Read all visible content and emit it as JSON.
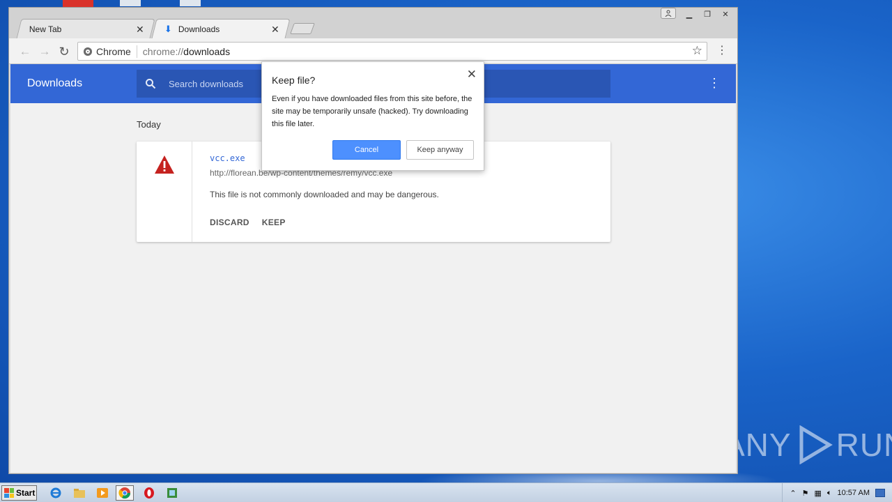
{
  "browser": {
    "tabs": [
      {
        "label": "New Tab",
        "active": false
      },
      {
        "label": "Downloads",
        "active": true
      }
    ],
    "omnibox": {
      "badge": "Chrome",
      "url_scheme": "chrome://",
      "url_host": "downloads"
    }
  },
  "downloads_page": {
    "title": "Downloads",
    "search_placeholder": "Search downloads",
    "date_group": "Today",
    "item": {
      "filename": "vcc.exe",
      "url": "http://florean.be/wp-content/themes/remy/vcc.exe",
      "warning": "This file is not commonly downloaded and may be dangerous.",
      "discard_label": "DISCARD",
      "keep_label": "KEEP"
    }
  },
  "dialog": {
    "title": "Keep file?",
    "body": "Even if you have downloaded files from this site before, the site may be temporarily unsafe (hacked). Try downloading this file later.",
    "cancel_label": "Cancel",
    "keep_label": "Keep anyway"
  },
  "taskbar": {
    "start_label": "Start",
    "clock": "10:57 AM"
  },
  "watermark": {
    "left": "ANY",
    "right": "RUN"
  },
  "colors": {
    "header_blue": "#3367d6",
    "primary_button": "#4d90fe",
    "warning_red": "#c5221f"
  }
}
